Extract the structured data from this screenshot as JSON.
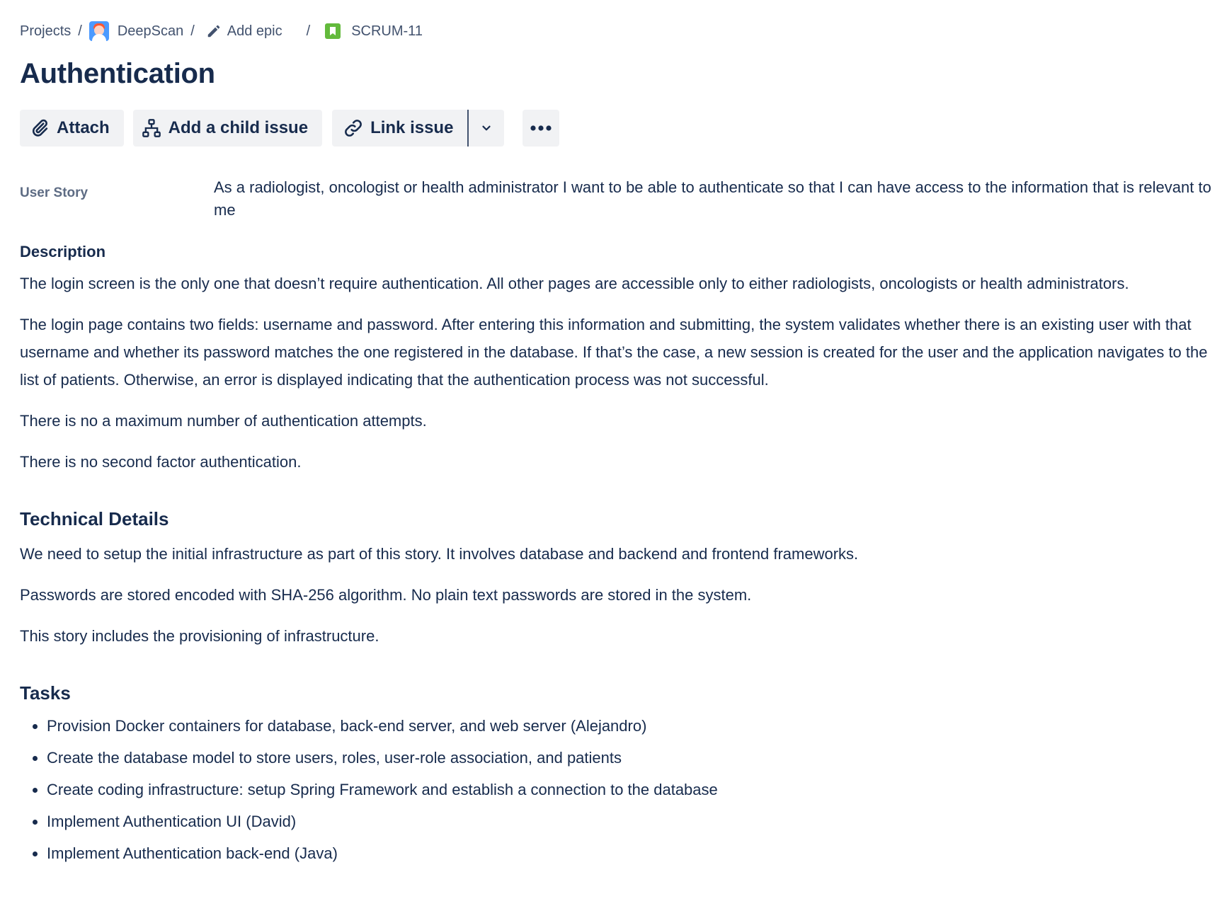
{
  "breadcrumb": {
    "projects": "Projects",
    "project_name": "DeepScan",
    "add_epic": "Add epic",
    "issue_key": "SCRUM-11",
    "separator": "/"
  },
  "issue": {
    "title": "Authentication"
  },
  "toolbar": {
    "attach_label": "Attach",
    "add_child_label": "Add a child issue",
    "link_issue_label": "Link issue"
  },
  "fields": {
    "user_story_label": "User Story",
    "user_story_value": "As a radiologist, oncologist or health administrator I want to be able to authenticate so that I can have access to the information that is relevant to me"
  },
  "description": {
    "heading": "Description",
    "paragraphs": [
      "The login screen is the only one that doesn’t require authentication. All other pages are accessible only to either radiologists, oncologists or health administrators.",
      "The login page contains two fields: username and password. After entering this information and submitting, the system validates whether there is an existing user with that username and whether its password matches the one registered in the database. If that’s the case, a new session is created for the user and the application navigates to the list of patients. Otherwise, an error is displayed indicating that the authentication process was not successful.",
      "There is no a maximum number of authentication attempts.",
      "There is no second factor authentication."
    ],
    "technical": {
      "heading": "Technical Details",
      "paragraphs": [
        "We need to setup the initial infrastructure as part of this story. It involves database and backend and frontend frameworks.",
        "Passwords are stored encoded with SHA-256 algorithm. No plain text passwords are stored in the system.",
        "This story includes the provisioning of infrastructure."
      ]
    },
    "tasks": {
      "heading": "Tasks",
      "items": [
        "Provision Docker containers for database, back-end server, and web server (Alejandro)",
        "Create the database model to store users, roles, user-role association, and patients",
        "Create coding infrastructure: setup Spring Framework and establish a connection to the database",
        "Implement Authentication UI (David)",
        "Implement Authentication back-end (Java)"
      ]
    }
  },
  "icons": {
    "avatar": "project-avatar-icon",
    "pencil": "pencil-icon",
    "story": "story-icon",
    "attach": "paperclip-icon",
    "child": "hierarchy-icon",
    "link": "link-icon",
    "dropdown": "chevron-down-icon",
    "more": "more-icon"
  },
  "colors": {
    "text_primary": "#172B4D",
    "text_secondary": "#42526E",
    "label_gray": "#5E6C84",
    "button_bg": "#F1F2F4",
    "story_green": "#63BA3C",
    "avatar_blue": "#4C9AFF"
  }
}
